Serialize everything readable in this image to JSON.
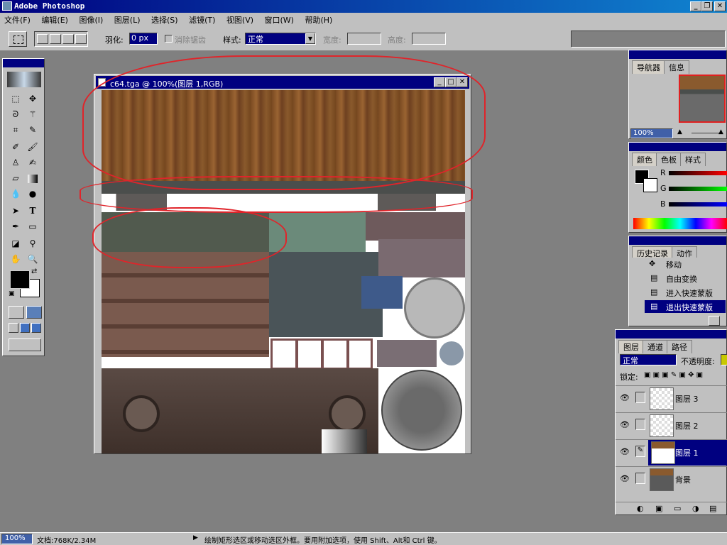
{
  "app": {
    "title": "Adobe Photoshop"
  },
  "menu": [
    "文件(F)",
    "编辑(E)",
    "图像(I)",
    "图层(L)",
    "选择(S)",
    "滤镜(T)",
    "视图(V)",
    "窗口(W)",
    "帮助(H)"
  ],
  "options": {
    "feather_label": "羽化:",
    "feather_value": "0 px",
    "antialias_label": "消除锯齿",
    "style_label": "样式:",
    "style_value": "正常",
    "width_label": "宽度:",
    "height_label": "高度:"
  },
  "document": {
    "title": "c64.tga @ 100%(图层 1,RGB)"
  },
  "navigator": {
    "tabs": [
      "导航器",
      "信息"
    ],
    "zoom": "100%"
  },
  "color": {
    "tabs": [
      "颜色",
      "色板",
      "样式"
    ],
    "r": "R",
    "g": "G",
    "b": "B"
  },
  "history": {
    "tabs": [
      "历史记录",
      "动作"
    ],
    "items": [
      "移动",
      "自由变换",
      "进入快速蒙版",
      "退出快速蒙版"
    ],
    "active_index": 3
  },
  "layers": {
    "tabs": [
      "图层",
      "通道",
      "路径"
    ],
    "blend_mode": "正常",
    "opacity_label": "不透明度:",
    "lock_label": "锁定:",
    "items": [
      "图层 3",
      "图层 2",
      "图层 1",
      "背景"
    ],
    "active_index": 2
  },
  "status": {
    "zoom": "100%",
    "doc": "文档:768K/2.34M",
    "hint": "绘制矩形选区或移动选区外框。要用附加选项，使用 Shift、Alt和 Ctrl 键。"
  },
  "colors": {
    "title_blue": "#000080",
    "selection_red": "#e0242a",
    "panel_gray": "#c0c0c0"
  }
}
